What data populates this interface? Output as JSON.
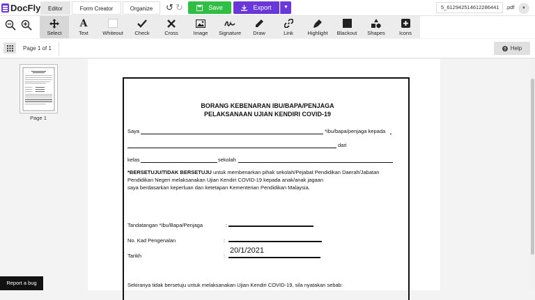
{
  "app": {
    "logo_text": "DocFly"
  },
  "top_tabs": [
    "Editor",
    "Form Creator",
    "Organize"
  ],
  "save_label": "Save",
  "export_label": "Export",
  "file": {
    "name": "5_612942514612286441",
    "ext": ".pdf"
  },
  "tools": [
    {
      "label": "Select",
      "icon": "move-icon"
    },
    {
      "label": "Text",
      "icon": "text-icon"
    },
    {
      "label": "Whiteout",
      "icon": "whiteout-icon"
    },
    {
      "label": "Check",
      "icon": "check-icon"
    },
    {
      "label": "Cross",
      "icon": "cross-icon"
    },
    {
      "label": "Image",
      "icon": "image-icon"
    },
    {
      "label": "Signature",
      "icon": "signature-icon"
    },
    {
      "label": "Draw",
      "icon": "pen-icon"
    },
    {
      "label": "Link",
      "icon": "link-icon"
    },
    {
      "label": "Highlight",
      "icon": "highlighter-icon"
    },
    {
      "label": "Blackout",
      "icon": "blackout-icon"
    },
    {
      "label": "Shapes",
      "icon": "shapes-icon"
    },
    {
      "label": "Icons",
      "icon": "plus-square-icon"
    }
  ],
  "page_count": "Page 1 of 1",
  "help_label": "Help",
  "thumb_label": "Page 1",
  "report_label": "Report a bug",
  "colors": {
    "accent": "#6a38d8",
    "save": "#2fbf44"
  },
  "doc": {
    "title1": "BORANG KEBENARAN IBU/BAPA/PENJAGA",
    "title2": "PELAKSANAAN UJIAN KENDIRI COVID-19",
    "saya": "Saya",
    "ibu_bapa": "*ibu/bapa/penjaga kepada",
    "dari": "dari",
    "kelas": "kelas",
    "sekolah": "sekolah",
    "consent_bold": "*BERSETUJU/TIDAK BERSETUJU",
    "consent_rest": " untuk membenarkan pihak sekolah/Pejabat Pendidikan Daerah/Jabatan",
    "consent_line2": "Pendidikan Negeri melaksanakan Ujian Kendiri COVID-19 kepada anak/anak jagaan",
    "consent_line3": "saya berdasarkan keperluan dan ketetapan Kementerian Pendidikan Malaysia.",
    "sig_label": "Tandatangan *Ibu/Bapa/Penjaga",
    "ic_label": "No. Kad Pengenalan",
    "date_label": "Tarikh",
    "colon": ":",
    "date_value": "20/1/2021",
    "footer": "Sekiranya tidak bersetuju untuk melaksanakan Ujian Kendiri COVID-19, sila nyatakan sebab:"
  }
}
